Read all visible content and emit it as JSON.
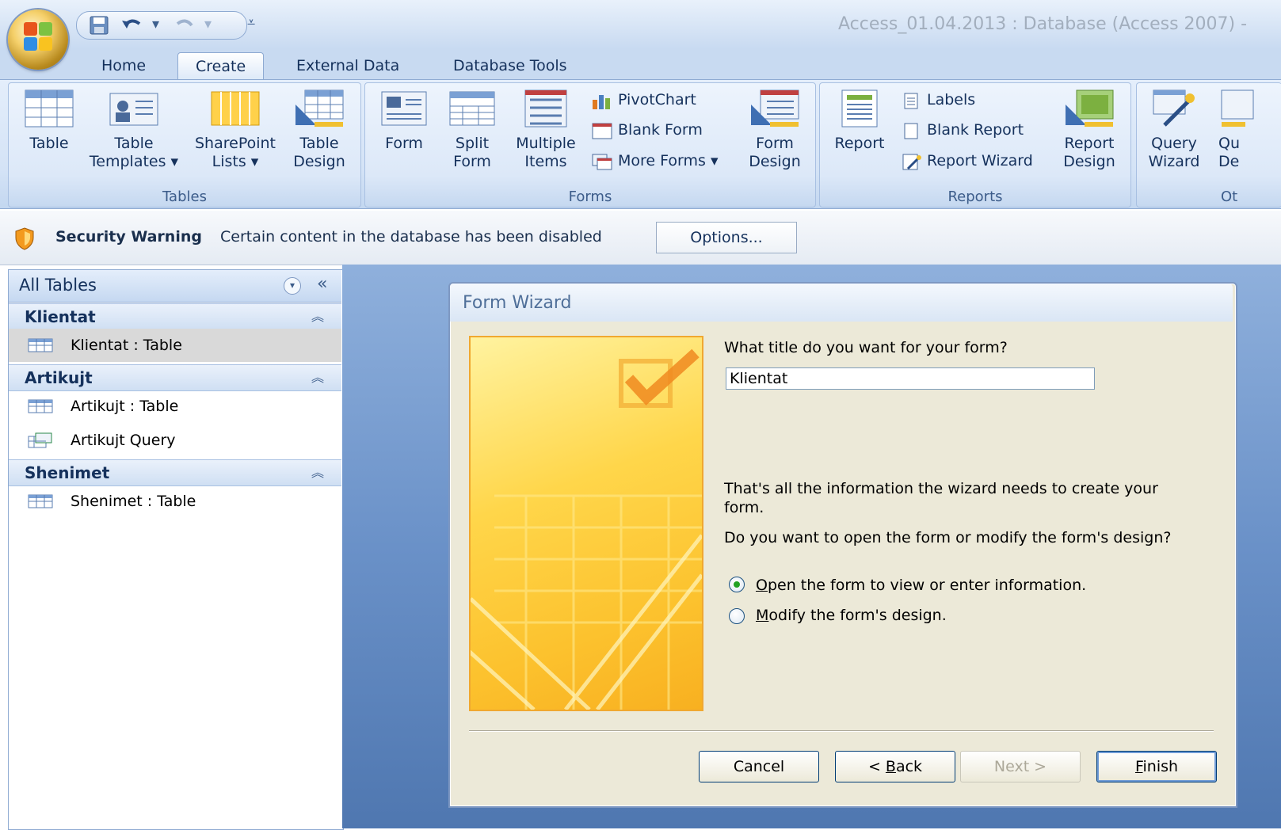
{
  "titlebar": {
    "app_title": "Access_01.04.2013 : Database (Access 2007) -"
  },
  "tabs": [
    {
      "label": "Home"
    },
    {
      "label": "Create"
    },
    {
      "label": "External Data"
    },
    {
      "label": "Database Tools"
    }
  ],
  "ribbon": {
    "tables": {
      "label": "Tables",
      "buttons": [
        {
          "line1": "Table",
          "line2": ""
        },
        {
          "line1": "Table",
          "line2": "Templates ▾"
        },
        {
          "line1": "SharePoint",
          "line2": "Lists ▾"
        },
        {
          "line1": "Table",
          "line2": "Design"
        }
      ]
    },
    "forms": {
      "label": "Forms",
      "buttons": [
        {
          "line1": "Form",
          "line2": ""
        },
        {
          "line1": "Split",
          "line2": "Form"
        },
        {
          "line1": "Multiple",
          "line2": "Items"
        }
      ],
      "small": [
        "PivotChart",
        "Blank Form",
        "More Forms ▾"
      ],
      "design": {
        "line1": "Form",
        "line2": "Design"
      }
    },
    "reports": {
      "label": "Reports",
      "report": "Report",
      "small": [
        "Labels",
        "Blank Report",
        "Report Wizard"
      ],
      "design": {
        "line1": "Report",
        "line2": "Design"
      }
    },
    "other": {
      "label": "Ot",
      "query_wizard": {
        "line1": "Query",
        "line2": "Wizard"
      },
      "query_design": {
        "line1": "Qu",
        "line2": "De"
      }
    }
  },
  "security": {
    "title": "Security Warning",
    "message": "Certain content in the database has been disabled",
    "options_label": "Options..."
  },
  "nav": {
    "title": "All Tables",
    "collapse_glyph": "«",
    "groups": [
      {
        "title": "Klientat",
        "items": [
          "Klientat : Table"
        ]
      },
      {
        "title": "Artikujt",
        "items": [
          "Artikujt : Table",
          "Artikujt Query"
        ]
      },
      {
        "title": "Shenimet",
        "items": [
          "Shenimet : Table"
        ]
      }
    ]
  },
  "wizard": {
    "title": "Form Wizard",
    "question": "What title do you want for your form?",
    "form_title_value": "Klientat",
    "info_line1": "That's all the information the wizard needs to create your",
    "info_line2": "form.",
    "question2": "Do you want to open the form or modify the form's design?",
    "option_open": {
      "accel": "O",
      "rest": "pen the form to view or enter information.",
      "selected": true
    },
    "option_modify": {
      "accel": "M",
      "rest": "odify the form's design.",
      "selected": false
    },
    "buttons": {
      "cancel": "Cancel",
      "back_prefix": "< ",
      "back_accel": "B",
      "back_rest": "ack",
      "next": "Next >",
      "finish_accel": "F",
      "finish_rest": "inish"
    }
  },
  "colors": {
    "ribbon_text": "#15315c",
    "workspace": "#6a91c8",
    "wizard_bg": "#ece9d8",
    "radio_dot": "#21a121"
  }
}
